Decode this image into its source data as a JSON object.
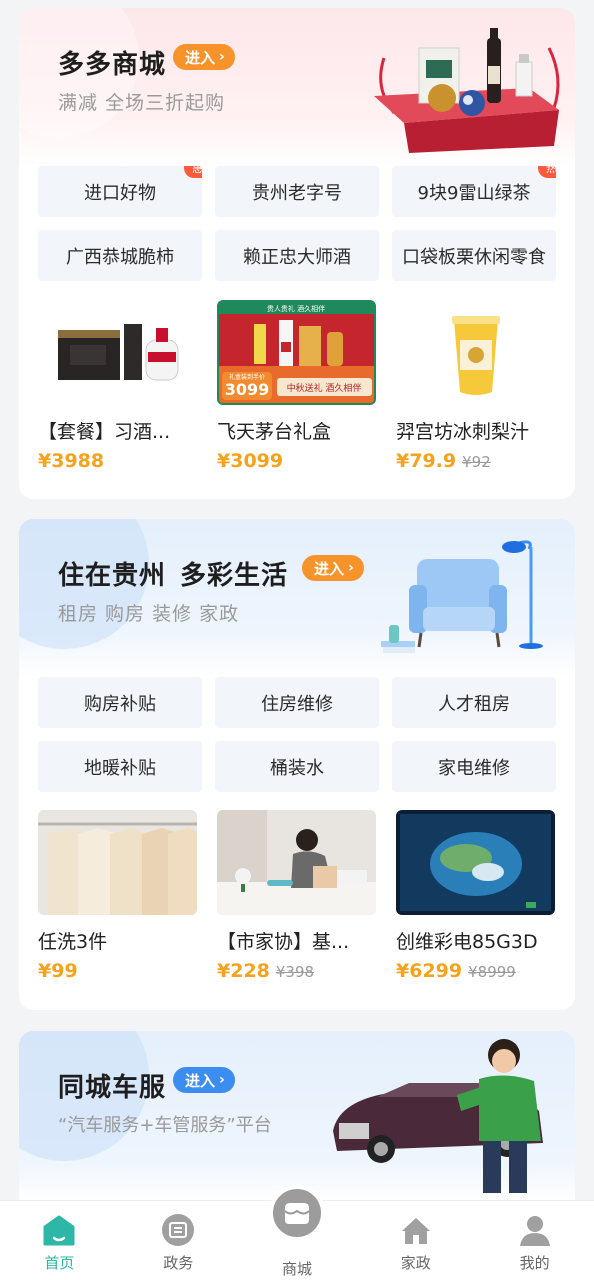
{
  "mall": {
    "title": "多多商城",
    "enter": "进入",
    "subtitle": "满减 全场三折起购",
    "chips": [
      {
        "label": "进口好物",
        "badge": "惠"
      },
      {
        "label": "贵州老字号",
        "badge": ""
      },
      {
        "label": "9块9雷山绿茶",
        "badge": "热"
      },
      {
        "label": "广西恭城脆柿",
        "badge": ""
      },
      {
        "label": "赖正忠大师酒",
        "badge": ""
      },
      {
        "label": "口袋板栗休闲零食",
        "badge": ""
      }
    ],
    "products": [
      {
        "name": "【套餐】习酒...",
        "price": "¥3988",
        "old_price": ""
      },
      {
        "name": "飞天茅台礼盒",
        "price": "¥3099",
        "old_price": "",
        "img_price": "3099",
        "img_banner": "贵人贵礼 酒久相伴",
        "img_tag": "中秋送礼 酒久相伴",
        "img_small": "礼盒装到手价"
      },
      {
        "name": "羿宫坊冰刺梨汁",
        "price": "¥79.9",
        "old_price": "¥92"
      }
    ]
  },
  "living": {
    "title": "住在贵州",
    "title2": "多彩生活",
    "enter": "进入",
    "subtitle": "租房  购房  装修  家政",
    "chips": [
      {
        "label": "购房补贴"
      },
      {
        "label": "住房维修"
      },
      {
        "label": "人才租房"
      },
      {
        "label": "地暖补贴"
      },
      {
        "label": "桶装水"
      },
      {
        "label": "家电维修"
      }
    ],
    "products": [
      {
        "name": "任洗3件",
        "price": "¥99",
        "old_price": ""
      },
      {
        "name": "【市家协】基...",
        "price": "¥228",
        "old_price": "¥398"
      },
      {
        "name": "创维彩电85G3D",
        "price": "¥6299",
        "old_price": "¥8999"
      }
    ]
  },
  "car": {
    "title": "同城车服",
    "enter": "进入",
    "subtitle": "“汽车服务+车管服务”平台"
  },
  "tabbar": [
    {
      "label": "首页",
      "icon": "home-icon",
      "active": true
    },
    {
      "label": "政务",
      "icon": "gov-icon",
      "active": false
    },
    {
      "label": "商城",
      "icon": "mall-icon",
      "active": false
    },
    {
      "label": "家政",
      "icon": "housekeeping-icon",
      "active": false
    },
    {
      "label": "我的",
      "icon": "profile-icon",
      "active": false
    }
  ],
  "colors": {
    "accent_teal": "#2cb7a6",
    "enter_orange": "#f7932b",
    "enter_blue": "#3b8df0",
    "price_orange": "#f5a21c",
    "badge_red": "#ff5a3c"
  }
}
